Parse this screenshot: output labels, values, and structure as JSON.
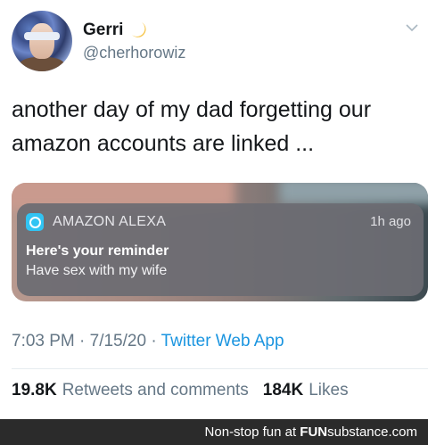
{
  "user": {
    "name": "Gerri",
    "handle": "@cherhorowiz",
    "moon_icon": "crescent-moon-icon"
  },
  "tweet": {
    "text": "another day of my dad forgetting our amazon accounts are linked ..."
  },
  "notification": {
    "app_name": "AMAZON ALEXA",
    "time_ago": "1h ago",
    "title": "Here's your reminder",
    "body": "Have sex with my wife",
    "icon": "alexa-icon"
  },
  "meta": {
    "timestamp": "7:03 PM · 7/15/20 · ",
    "source": "Twitter Web App"
  },
  "stats": {
    "retweets_count": "19.8K",
    "retweets_label": "Retweets and comments",
    "likes_count": "184K",
    "likes_label": "Likes"
  },
  "footer": {
    "text": "Non-stop fun at ",
    "brand_bold": "FUN",
    "brand_rest": "substance.com"
  },
  "colors": {
    "link": "#1b95e0",
    "muted": "#657786",
    "footer_bg": "#2b2b2b"
  }
}
